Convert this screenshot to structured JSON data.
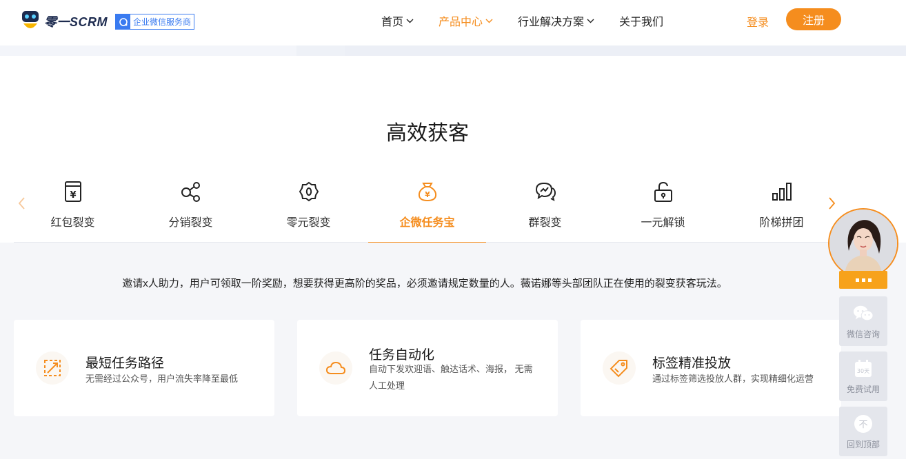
{
  "header": {
    "brand": "零一SCRM",
    "badge": "企业微信服务商",
    "nav": [
      {
        "label": "首页",
        "has_dropdown": true,
        "active": false
      },
      {
        "label": "产品中心",
        "has_dropdown": true,
        "active": true
      },
      {
        "label": "行业解决方案",
        "has_dropdown": true,
        "active": false
      },
      {
        "label": "关于我们",
        "has_dropdown": false,
        "active": false
      }
    ],
    "login": "登录",
    "register": "注册"
  },
  "section": {
    "title": "高效获客",
    "tabs": [
      {
        "label": "红包裂变",
        "icon": "red-envelope-icon"
      },
      {
        "label": "分销裂变",
        "icon": "share-nodes-icon"
      },
      {
        "label": "零元裂变",
        "icon": "zero-badge-icon"
      },
      {
        "label": "企微任务宝",
        "icon": "money-bag-icon",
        "active": true
      },
      {
        "label": "群裂变",
        "icon": "chat-bubbles-icon"
      },
      {
        "label": "一元解锁",
        "icon": "unlock-icon"
      },
      {
        "label": "阶梯拼团",
        "icon": "bar-steps-icon"
      }
    ],
    "description": "邀请x人助力，用户可领取一阶奖励，想要获得更高阶的奖品，必须邀请规定数量的人。薇诺娜等头部团队正在使用的裂变获客玩法。",
    "cards": [
      {
        "title": "最短任务路径",
        "subtitle": "无需经过公众号，用户流失率降至最低",
        "icon": "shortest-path-icon"
      },
      {
        "title": "任务自动化",
        "subtitle": "自动下发欢迎语、触达话术、海报， 无需人工处理",
        "icon": "cloud-icon"
      },
      {
        "title": "标签精准投放",
        "subtitle": "通过标签筛选投放人群，实现精细化运营",
        "icon": "tag-icon"
      }
    ]
  },
  "float": {
    "items": [
      {
        "label": "微信咨询",
        "icon": "wechat-icon"
      },
      {
        "label": "免费试用",
        "icon": "calendar-icon",
        "icon_text": "30天"
      },
      {
        "label": "回到顶部",
        "icon": "back-to-top-icon",
        "icon_text": "不"
      }
    ]
  },
  "colors": {
    "accent": "#f58d1e",
    "badge_blue": "#3a7bf0",
    "panel_bg": "#f5f6f9"
  }
}
